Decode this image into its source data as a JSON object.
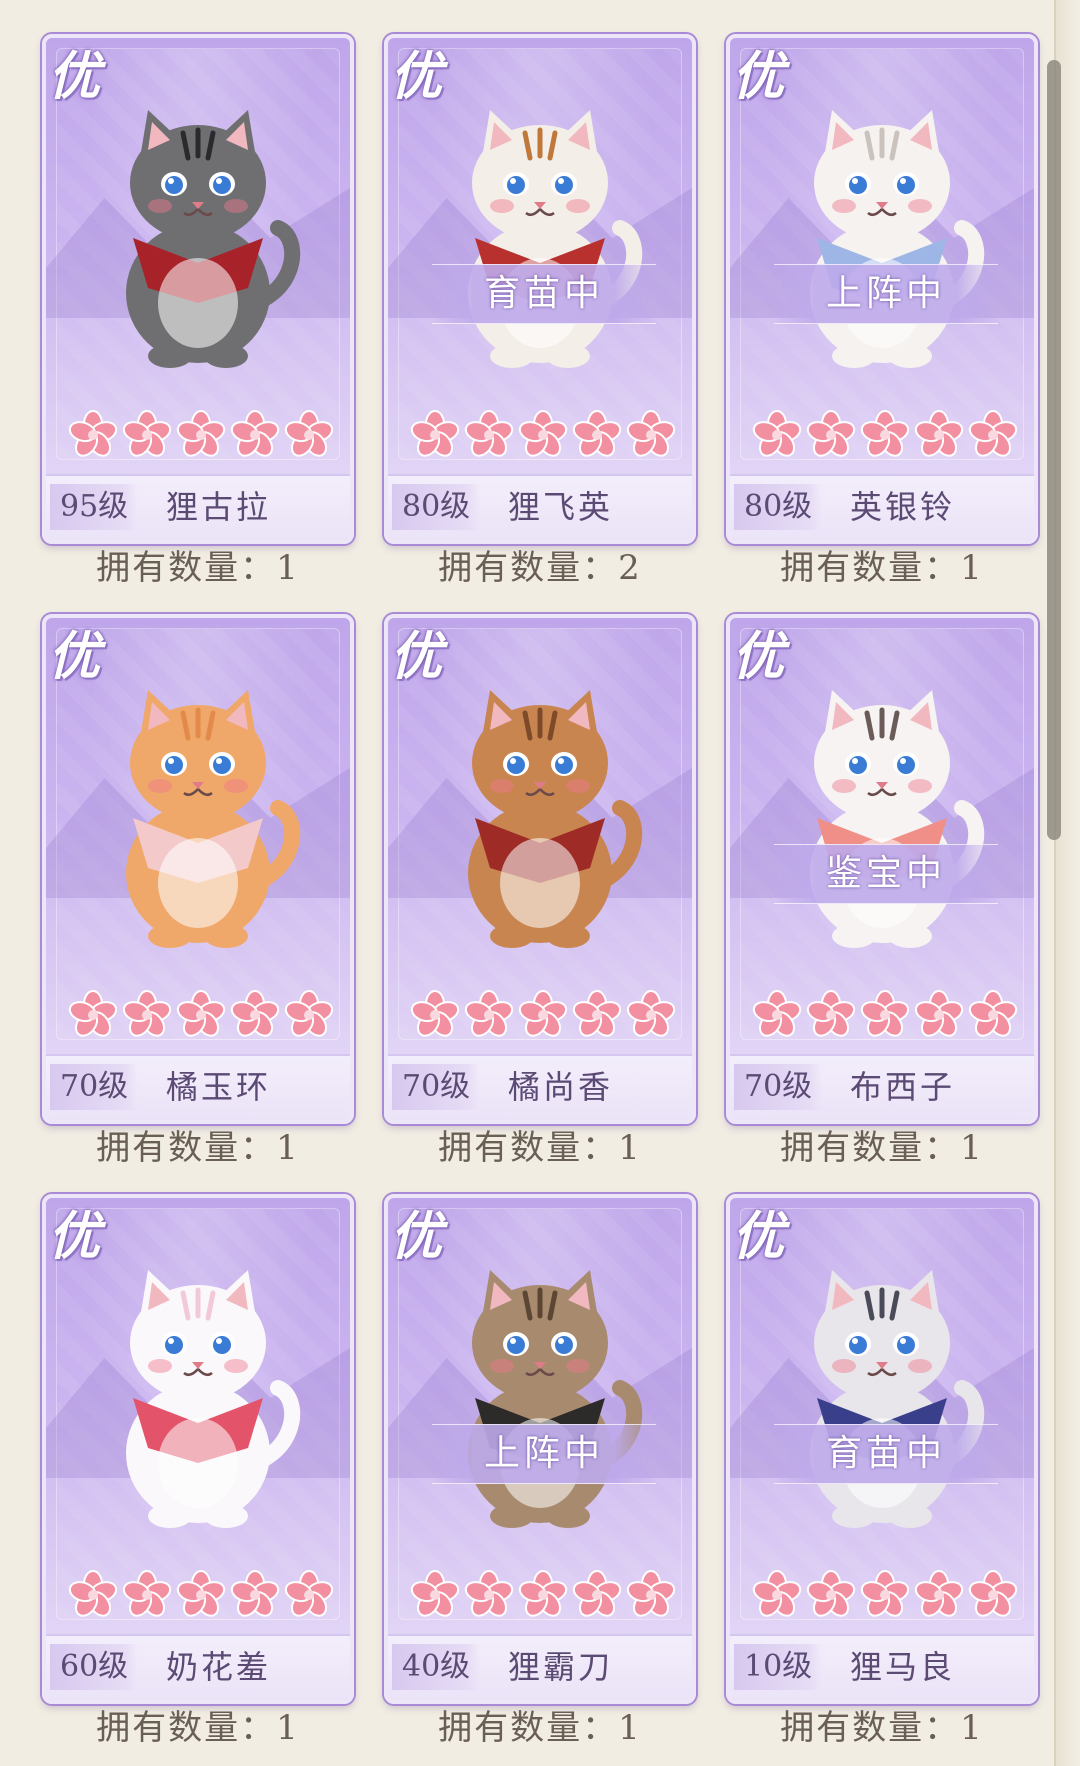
{
  "quality_label": "优",
  "count_label": "拥有数量：",
  "cards": [
    {
      "level": "95级",
      "name": "狸古拉",
      "count": "1",
      "status": "",
      "fur": "#6f6f72",
      "accent": "#2a2a2e",
      "cape": "#a8222a"
    },
    {
      "level": "80级",
      "name": "狸飞英",
      "count": "2",
      "status": "育苗中",
      "fur": "#f3eee8",
      "accent": "#c0773a",
      "cape": "#b8312e"
    },
    {
      "level": "80级",
      "name": "英银铃",
      "count": "1",
      "status": "上阵中",
      "fur": "#f5f2f0",
      "accent": "#c9c2bd",
      "cape": "#9db6e6"
    },
    {
      "level": "70级",
      "name": "橘玉环",
      "count": "1",
      "status": "",
      "fur": "#f0a86a",
      "accent": "#e3894a",
      "cape": "#f3c9c9"
    },
    {
      "level": "70级",
      "name": "橘尚香",
      "count": "1",
      "status": "",
      "fur": "#c98550",
      "accent": "#7d4a2a",
      "cape": "#9e2b25"
    },
    {
      "level": "70级",
      "name": "布西子",
      "count": "1",
      "status": "鉴宝中",
      "fur": "#f6f3f2",
      "accent": "#6a5a58",
      "cape": "#f08f88"
    },
    {
      "level": "60级",
      "name": "奶花羞",
      "count": "1",
      "status": "",
      "fur": "#fbf8fb",
      "accent": "#f2c9d8",
      "cape": "#e3546a"
    },
    {
      "level": "40级",
      "name": "狸霸刀",
      "count": "1",
      "status": "上阵中",
      "fur": "#a88a6e",
      "accent": "#5b4533",
      "cape": "#2d2a2a"
    },
    {
      "level": "10级",
      "name": "狸马良",
      "count": "1",
      "status": "育苗中",
      "fur": "#e8e6ea",
      "accent": "#4a4a58",
      "cape": "#3a3f8c"
    }
  ]
}
